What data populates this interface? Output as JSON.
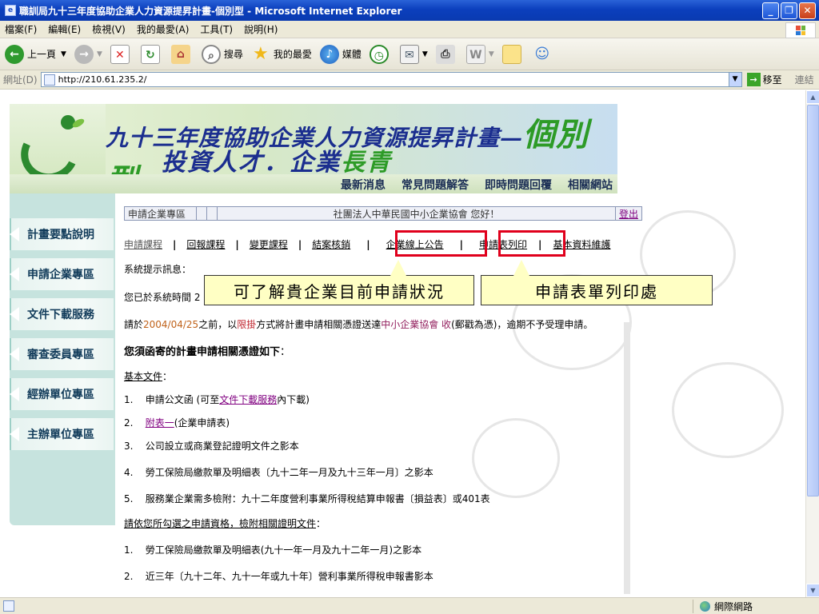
{
  "window": {
    "title": "職訓局九十三年度協助企業人力資源提昇計畫-個別型 - Microsoft Internet Explorer"
  },
  "menu": [
    "檔案(F)",
    "編輯(E)",
    "檢視(V)",
    "我的最愛(A)",
    "工具(T)",
    "說明(H)"
  ],
  "toolbar": {
    "back": "上一頁",
    "search": "搜尋",
    "favorites": "我的最愛",
    "media": "媒體"
  },
  "address": {
    "label": "網址(D)",
    "url": "http://210.61.235.2/",
    "go": "移至",
    "links": "連結"
  },
  "status": {
    "zone": "網際網路"
  },
  "banner": {
    "line1": "九十三年度協助企業人力資源提昇計畫",
    "line1_em": "個別型",
    "line2": "投資人才．企業",
    "line2_em": "長青"
  },
  "topnav": [
    "最新消息",
    "常見問題解答",
    "即時問題回覆",
    "相關網站"
  ],
  "sidebar": [
    "計畫要點說明",
    "申請企業專區",
    "文件下載服務",
    "審查委員專區",
    "經辦單位專區",
    "主辦單位專區"
  ],
  "infobar": {
    "section": "申請企業專區",
    "welcome": "社團法人中華民國中小企業協會 您好！",
    "logout": "登出"
  },
  "subnav": [
    "申請課程",
    "回報課程",
    "變更課程",
    "結案核銷",
    "企業線上公告",
    "申請表列印",
    "基本資料維護"
  ],
  "content": {
    "system_msg": "系統提示訊息：",
    "line_partial": "您已於系統時間 2",
    "deadline_pre": "請於",
    "deadline_date": "2004/04/25",
    "deadline_mid": "之前，以",
    "deadline_method": "限掛",
    "deadline_mid2": "方式將計畫申請相關憑證送達",
    "deadline_org": "中小企業協會 收",
    "deadline_post": "(郵戳為憑)，逾期不予受理申請。",
    "heading": "您須函寄的計畫申請相關憑證如下",
    "heading_colon": "：",
    "basic_docs": "基本文件",
    "basic_colon": "：",
    "item1_pre": "1.    申請公文函 (可至",
    "item1_link": "文件下載服務",
    "item1_post": "內下載)",
    "item2_pre": "2.    ",
    "item2_link": "附表一",
    "item2_post": "(企業申請表)",
    "item3": "3.    公司設立或商業登記證明文件之影本",
    "item4": "4.    勞工保險局繳款單及明細表〔九十二年一月及九十三年一月〕之影本",
    "item5": "5.    服務業企業需多檢附：九十二年度營利事業所得稅結算申報書〔損益表〕或401表",
    "qual_heading": "請依您所勾選之申請資格，檢附相關證明文件",
    "qual_colon": "：",
    "q1": "1.    勞工保險局繳款單及明細表(九十一年一月及九十二年一月)之影本",
    "q2": "2.    近三年〔九十二年、九十一年或九十年〕營利事業所得稅申報書影本"
  },
  "callouts": {
    "left": "可了解貴企業目前申請狀況",
    "right": "申請表單列印處"
  },
  "colors": {
    "highlight": "#e0001c",
    "callout_bg": "#ffffc4",
    "sidebar_track": "#c6e3de"
  }
}
